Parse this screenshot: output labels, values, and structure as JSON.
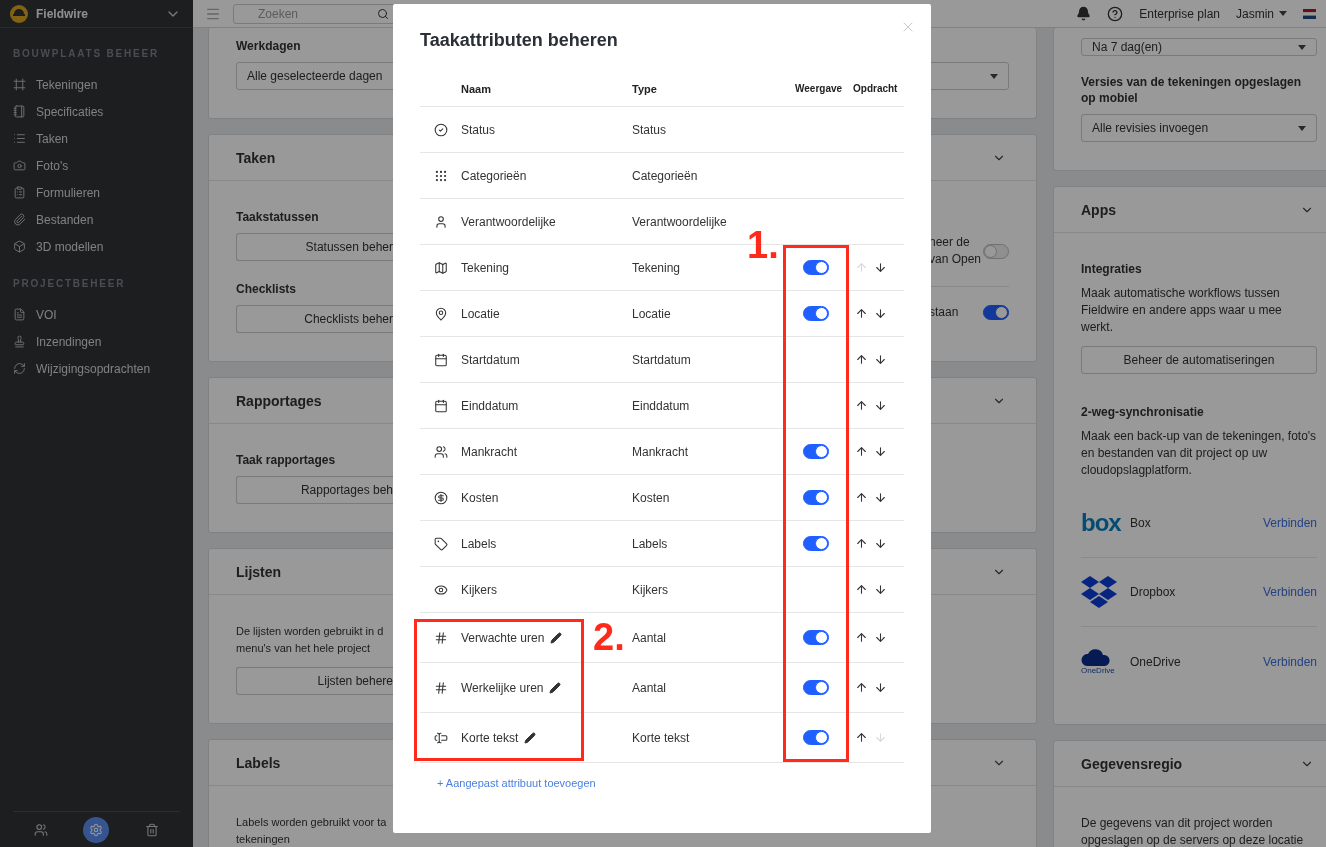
{
  "sidebar": {
    "brand": "Fieldwire",
    "sections": [
      {
        "title": "BOUWPLAATS BEHEER",
        "items": [
          {
            "label": "Tekeningen"
          },
          {
            "label": "Specificaties"
          },
          {
            "label": "Taken"
          },
          {
            "label": "Foto's"
          },
          {
            "label": "Formulieren"
          },
          {
            "label": "Bestanden"
          },
          {
            "label": "3D modellen"
          }
        ]
      },
      {
        "title": "PROJECTBEHEER",
        "items": [
          {
            "label": "VOI"
          },
          {
            "label": "Inzendingen"
          },
          {
            "label": "Wijzigingsopdrachten"
          }
        ]
      }
    ],
    "footer": [
      {
        "selected": false
      },
      {
        "selected": true
      },
      {
        "selected": false
      }
    ]
  },
  "topbar": {
    "search": {
      "placeholder": "Zoeken"
    },
    "plan": "Enterprise plan",
    "user": "Jasmin"
  },
  "left_cards": [
    {
      "blocks": [
        {
          "kind": "label",
          "text": "Werkdagen"
        },
        {
          "kind": "select",
          "text": "Alle geselecteerde dagen"
        }
      ]
    },
    {
      "title": "Taken",
      "blocks": [
        {
          "kind": "label",
          "text": "Taakstatussen"
        },
        {
          "kind": "button",
          "text": "Statussen beher"
        },
        {
          "kind": "label",
          "text": "Checklists"
        },
        {
          "kind": "button",
          "text": "Checklists beher"
        }
      ],
      "side": [
        {
          "lines": [
            "neer de",
            "van Open"
          ],
          "on": false
        },
        {
          "lines": [
            "staan"
          ],
          "on": true
        }
      ]
    },
    {
      "title": "Rapportages",
      "blocks": [
        {
          "kind": "label",
          "text": "Taak rapportages"
        },
        {
          "kind": "button",
          "text": "Rapportages beh"
        }
      ]
    },
    {
      "title": "Lijsten",
      "blocks": [
        {
          "kind": "text",
          "lines": [
            "De lijsten worden gebruikt in d",
            "menu's van het hele project"
          ]
        },
        {
          "kind": "button",
          "text": "Lijsten behere"
        }
      ]
    },
    {
      "title": "Labels",
      "blocks": [
        {
          "kind": "text",
          "lines": [
            "Labels worden gebruikt voor ta",
            "tekeningen"
          ]
        }
      ]
    }
  ],
  "right_cards": [
    {
      "blocks": [
        {
          "kind": "select",
          "text": "Na 7 dag(en)"
        },
        {
          "kind": "label",
          "text": "Versies van de tekeningen opgeslagen op mobiel"
        },
        {
          "kind": "select",
          "text": "Alle revisies invoegen"
        }
      ]
    },
    {
      "title": "Apps",
      "blocks": [
        {
          "kind": "label",
          "text": "Integraties"
        },
        {
          "kind": "text",
          "lines": [
            "Maak automatische workflows tussen Fieldwire en andere apps waar u mee werkt."
          ]
        },
        {
          "kind": "button",
          "text": "Beheer de automatiseringen"
        },
        {
          "kind": "label",
          "text": "2-weg-synchronisatie"
        },
        {
          "kind": "text",
          "lines": [
            "Maak een back-up van de tekeningen, foto's en bestanden van dit project op uw cloudopslagplatform."
          ]
        },
        {
          "kind": "services",
          "items": [
            {
              "wordmark": "box",
              "name": "Box",
              "action": "Verbinden"
            },
            {
              "name": "Dropbox",
              "action": "Verbinden"
            },
            {
              "wordmark": "OneDrive",
              "name": "OneDrive",
              "action": "Verbinden"
            }
          ]
        }
      ]
    },
    {
      "title": "Gegevensregio",
      "blocks": [
        {
          "kind": "text",
          "lines": [
            "De gegevens van dit project worden opgeslagen op de servers op deze locatie"
          ]
        }
      ]
    }
  ],
  "modal": {
    "title": "Taakattributen beheren",
    "columns": [
      "Naam",
      "Type",
      "Weergave",
      "Opdracht"
    ],
    "rows": [
      {
        "name": "Status",
        "type": "Status",
        "kind": "fixed",
        "editable": false
      },
      {
        "name": "Categorieën",
        "type": "Categorieën",
        "kind": "fixed",
        "editable": false
      },
      {
        "name": "Verantwoordelijke",
        "type": "Verantwoordelijke",
        "kind": "fixed",
        "editable": false
      },
      {
        "name": "Tekening",
        "type": "Tekening",
        "kind": "toggle",
        "on": true,
        "editable": false,
        "up_disabled": true,
        "down_disabled": false
      },
      {
        "name": "Locatie",
        "type": "Locatie",
        "kind": "toggle",
        "on": true,
        "editable": false,
        "up_disabled": false,
        "down_disabled": false
      },
      {
        "name": "Startdatum",
        "type": "Startdatum",
        "kind": "sortable",
        "editable": false,
        "up_disabled": false,
        "down_disabled": false
      },
      {
        "name": "Einddatum",
        "type": "Einddatum",
        "kind": "sortable",
        "editable": false,
        "up_disabled": false,
        "down_disabled": false
      },
      {
        "name": "Mankracht",
        "type": "Mankracht",
        "kind": "toggle",
        "on": true,
        "editable": false,
        "up_disabled": false,
        "down_disabled": false
      },
      {
        "name": "Kosten",
        "type": "Kosten",
        "kind": "toggle",
        "on": true,
        "editable": false,
        "up_disabled": false,
        "down_disabled": false
      },
      {
        "name": "Labels",
        "type": "Labels",
        "kind": "toggle",
        "on": true,
        "editable": false,
        "up_disabled": false,
        "down_disabled": false
      },
      {
        "name": "Kijkers",
        "type": "Kijkers",
        "kind": "sortable",
        "editable": false,
        "up_disabled": false,
        "down_disabled": false
      },
      {
        "name": "Verwachte uren",
        "type": "Aantal",
        "kind": "toggle",
        "on": true,
        "editable": true,
        "up_disabled": false,
        "down_disabled": false
      },
      {
        "name": "Werkelijke uren",
        "type": "Aantal",
        "kind": "toggle",
        "on": true,
        "editable": true,
        "up_disabled": false,
        "down_disabled": false
      },
      {
        "name": "Korte tekst",
        "type": "Korte tekst",
        "kind": "toggle",
        "on": true,
        "editable": true,
        "up_disabled": false,
        "down_disabled": true
      }
    ],
    "add_link": "+ Aangepast attribuut toevoegen",
    "annotations": [
      {
        "label": "1."
      },
      {
        "label": "2."
      }
    ]
  }
}
